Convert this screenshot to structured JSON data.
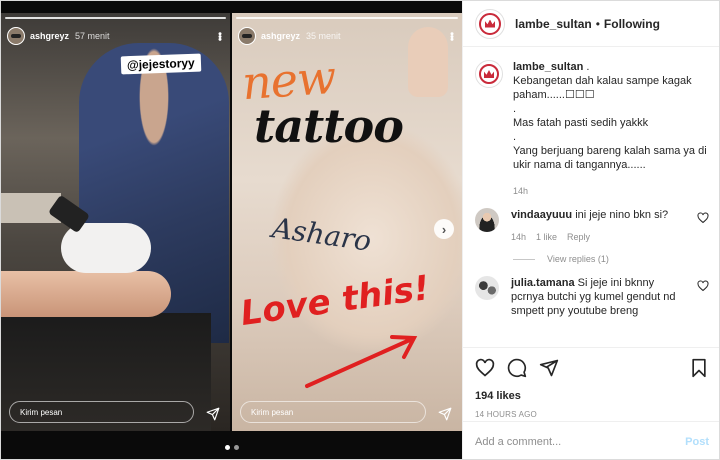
{
  "stories": [
    {
      "username": "ashgreyz",
      "time": "57 menit",
      "mention": "@jejestoryy",
      "reply_placeholder": "Kirim pesan"
    },
    {
      "username": "ashgreyz",
      "time": "35 menit",
      "title_new": "new",
      "title_tattoo": "tattoo",
      "ink_text": "Asharo",
      "love_text": "Love this!",
      "reply_placeholder": "Kirim pesan"
    }
  ],
  "post": {
    "account": "lambe_sultan",
    "separator": "•",
    "follow_status": "Following",
    "caption": {
      "username": "lambe_sultan",
      "lines": [
        ".",
        "Kebangetan dah kalau sampe kagak paham......☐☐☐",
        ".",
        "Mas fatah pasti sedih yakkk",
        ".",
        "Yang berjuang bareng kalah sama ya di ukir nama di tangannya......"
      ],
      "time": "14h"
    },
    "comments": [
      {
        "username": "vindaayuuu",
        "text": "ini jeje nino bkn si?",
        "time": "14h",
        "likes": "1 like",
        "reply": "Reply",
        "view_replies": "View replies (1)"
      },
      {
        "username": "julia.tamana",
        "text": "Si jeje ini bknny pcrnya butchi yg kumel gendut nd smpett pny youtube breng",
        "time": "",
        "likes": "",
        "reply": ""
      }
    ],
    "likes": "194 likes",
    "ago": "14 HOURS AGO",
    "add_comment_placeholder": "Add a comment...",
    "post_button": "Post"
  },
  "colors": {
    "brand_red": "#c92a3a",
    "link_blue": "#b2dffc",
    "muted": "#8e8e8e"
  }
}
